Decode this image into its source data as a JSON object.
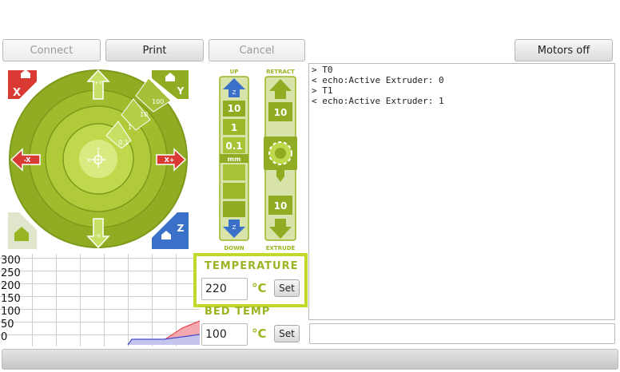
{
  "toolbar": {
    "connect_label": "Connect",
    "print_label": "Print",
    "cancel_label": "Cancel",
    "motors_off_label": "Motors off"
  },
  "xy_control": {
    "home_x_label": "X",
    "home_y_label": "Y",
    "home_z_label": "Z",
    "axis_y_plus": "+Y",
    "axis_y_minus": "-Y",
    "axis_x_plus": "X+",
    "axis_x_minus": "-X",
    "center_y": "Y",
    "center_x": "X",
    "steps": [
      "0.1",
      "1",
      "10",
      "100"
    ]
  },
  "z_control": {
    "up_label": "UP",
    "down_label": "DOWN",
    "steps": [
      "10",
      "1",
      "0.1"
    ],
    "unit": "mm",
    "axis": "Z"
  },
  "extruder_control": {
    "retract_label": "RETRACT",
    "extrude_label": "EXTRUDE",
    "retract_amount": "10",
    "extrude_amount": "10"
  },
  "console": {
    "lines": [
      "> T0",
      "< echo:Active Extruder: 0",
      "> T1",
      "< echo:Active Extruder: 1"
    ]
  },
  "temperature": {
    "title": "TEMPERATURE",
    "value": "220",
    "unit": "°C",
    "set_label": "Set"
  },
  "bed_temp": {
    "title": "BED TEMP",
    "value": "100",
    "unit": "°C",
    "set_label": "Set"
  },
  "graph": {
    "y_labels": [
      "300",
      "250",
      "200",
      "150",
      "100",
      "50",
      "0"
    ],
    "colors": {
      "hotend": "#e8303a",
      "bed": "#4a4ad0"
    }
  },
  "colors": {
    "accent": "#9ab524",
    "home_red": "#d93a34",
    "home_blue": "#3a70c8"
  }
}
